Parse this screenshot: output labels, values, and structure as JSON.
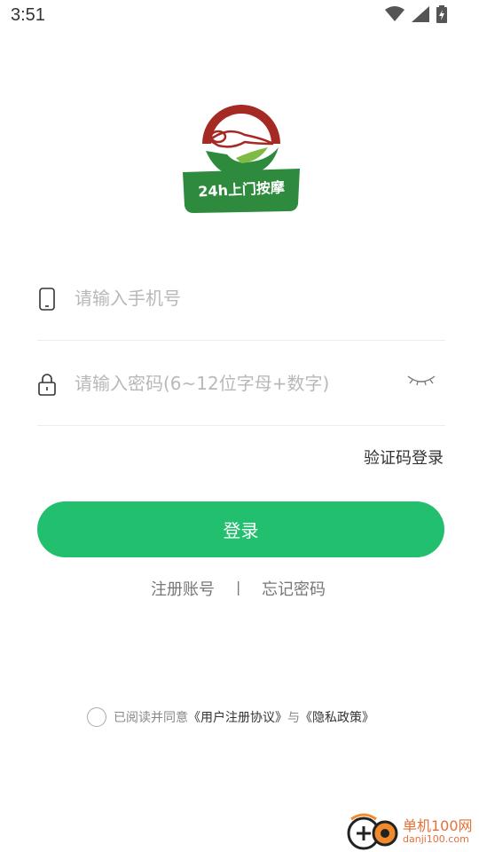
{
  "status_bar": {
    "time": "3:51",
    "icons": [
      "wifi-icon",
      "signal-icon",
      "battery-charging-icon"
    ]
  },
  "logo": {
    "caption": "24h上门按摩",
    "colors": {
      "red": "#a52a23",
      "green": "#2e8b3e",
      "light_green": "#7dbb45"
    }
  },
  "form": {
    "phone": {
      "placeholder": "请输入手机号",
      "value": "",
      "icon": "phone-icon"
    },
    "password": {
      "placeholder": "请输入密码(6~12位字母+数字)",
      "value": "",
      "icon": "lock-icon",
      "toggle_icon": "eye-closed-icon"
    },
    "sms_login_label": "验证码登录",
    "login_label": "登录"
  },
  "links": {
    "register": "注册账号",
    "separator": "|",
    "forgot": "忘记密码"
  },
  "agreement": {
    "prefix": "已阅读并同意",
    "user_agreement": "《用户注册协议》",
    "conjunction": "与",
    "privacy_policy": "《隐私政策》"
  },
  "watermark": {
    "line1": "单机100网",
    "line2": "danji100.com"
  },
  "colors": {
    "accent": "#22bf6f",
    "placeholder": "#b8b8b8",
    "link": "#777777"
  }
}
